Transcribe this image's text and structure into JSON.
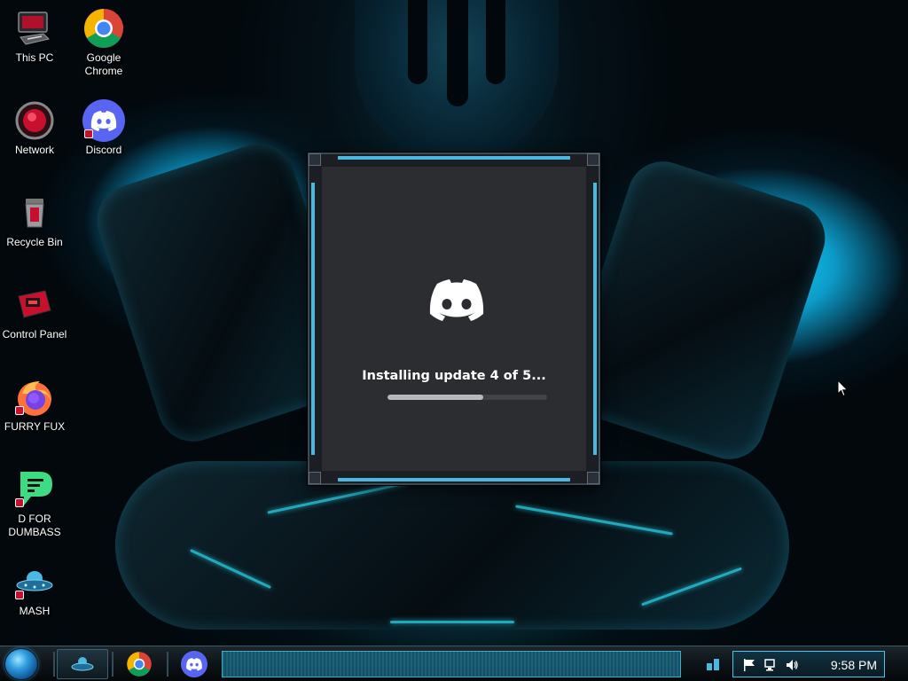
{
  "desktop": {
    "icons": [
      {
        "label": "This PC",
        "icon": "computer-icon"
      },
      {
        "label": "Google Chrome",
        "icon": "chrome-icon"
      },
      {
        "label": "Network",
        "icon": "network-icon"
      },
      {
        "label": "Discord",
        "icon": "discord-icon"
      },
      {
        "label": "Recycle Bin",
        "icon": "recycle-bin-icon"
      },
      {
        "label": "Control Panel",
        "icon": "control-panel-icon"
      },
      {
        "label": "FURRY FUX",
        "icon": "firefox-icon"
      },
      {
        "label": "D FOR DUMBASS",
        "icon": "chat-app-icon"
      },
      {
        "label": "MASH",
        "icon": "ufo-icon"
      }
    ]
  },
  "updater": {
    "status": "Installing update 4 of 5...",
    "progress": 0.6,
    "icon": "discord-logo-icon",
    "colors": {
      "background": "#2b2d31",
      "track": "#3f4248",
      "fill": "#b5bac1"
    }
  },
  "taskbar": {
    "pinned": [
      {
        "name": "MASH",
        "icon": "ufo-icon"
      },
      {
        "name": "Google Chrome",
        "icon": "chrome-icon"
      },
      {
        "name": "Discord",
        "icon": "discord-icon"
      }
    ],
    "tray_icons": [
      "flag-icon",
      "network-icon",
      "volume-icon"
    ],
    "clock": "9:58 PM",
    "accent": "#4ec3e6"
  }
}
